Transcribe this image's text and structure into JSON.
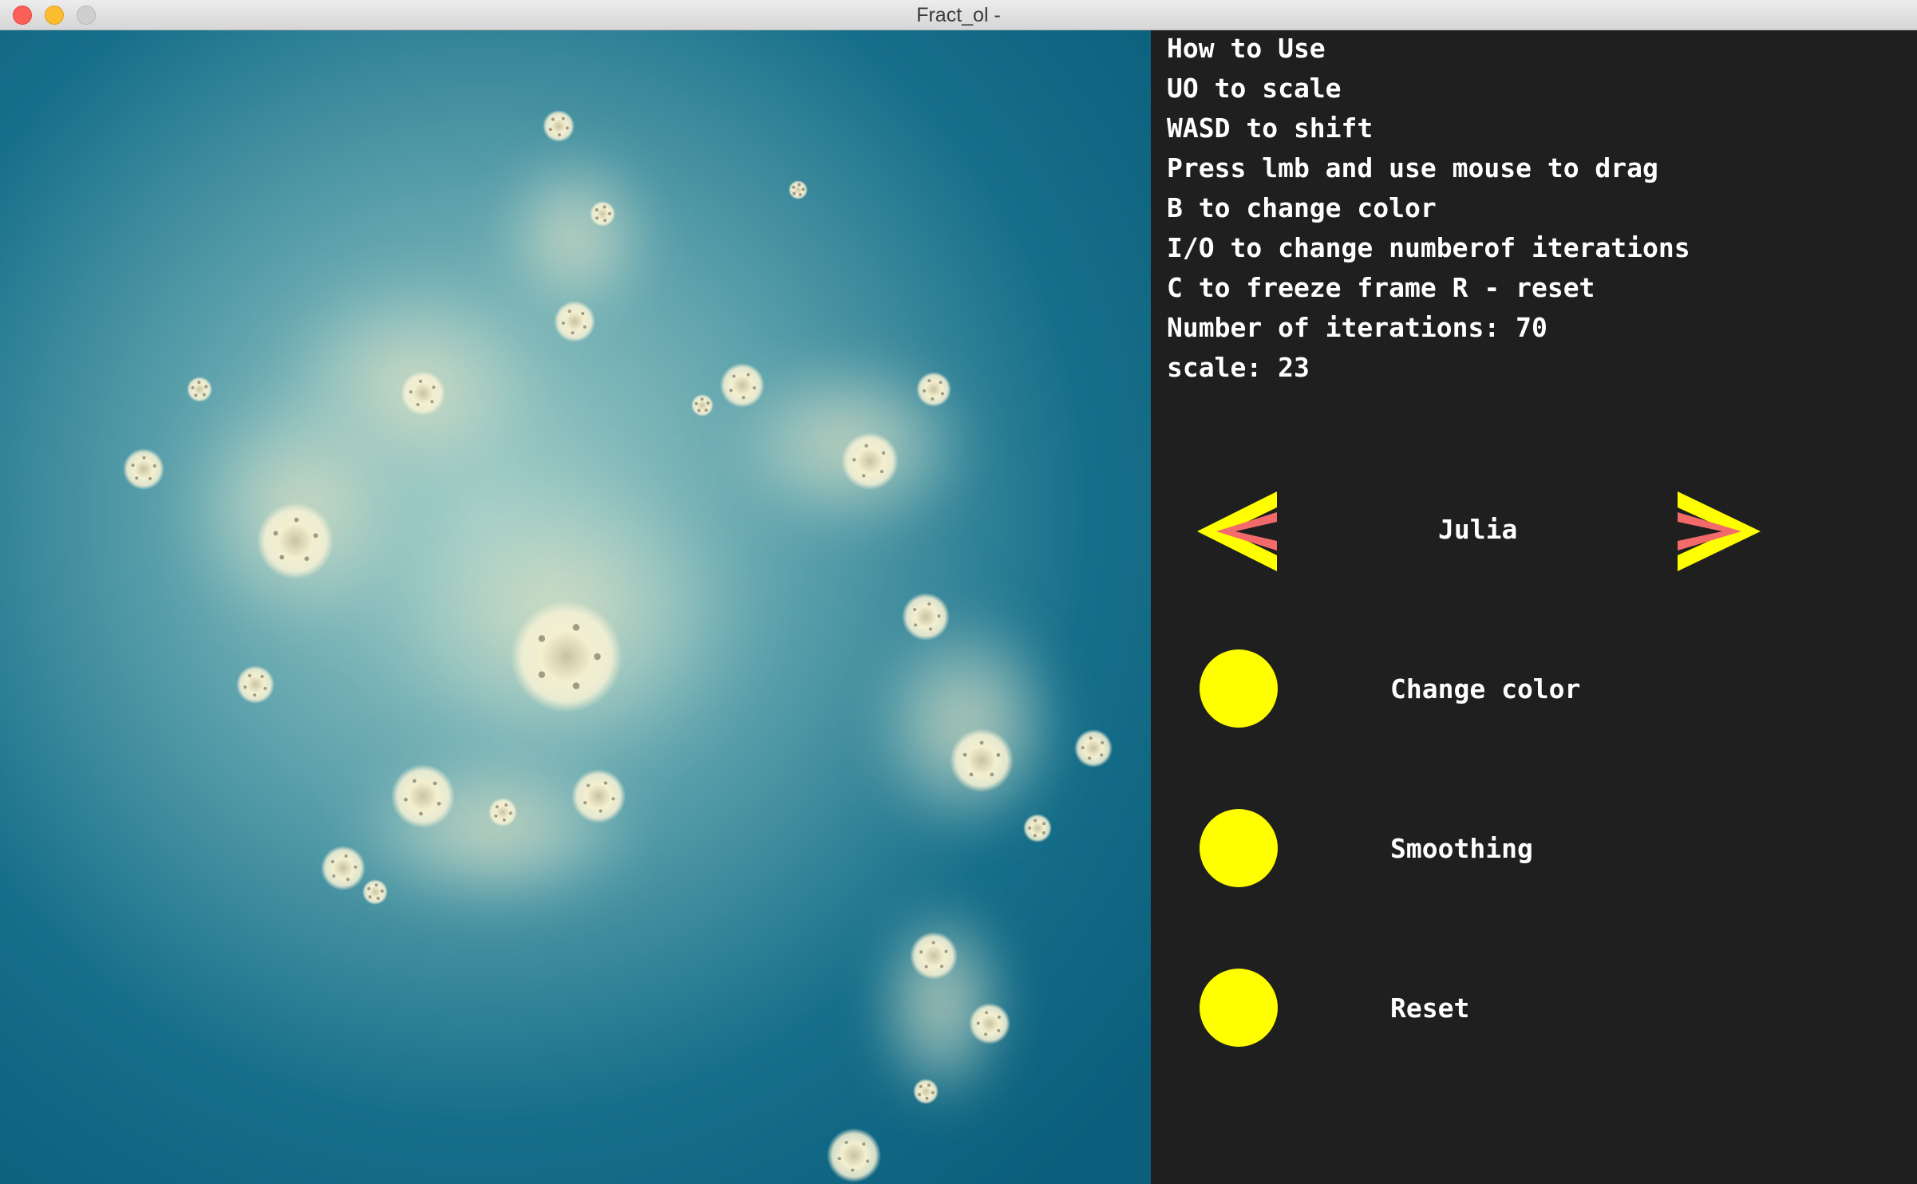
{
  "window": {
    "title": "Fract_ol -"
  },
  "help": {
    "lines": [
      "How to Use",
      "UO to scale",
      "WASD to shift",
      "Press lmb and use mouse to drag",
      "B to change color",
      "I/O to change numberof iterations",
      "C to freeze frame R - reset",
      "Number of iterations: 70",
      "scale: 23"
    ]
  },
  "selector": {
    "current_fractal": "Julia",
    "prev_icon": "chevron-left-icon",
    "next_icon": "chevron-right-icon"
  },
  "options": [
    {
      "label": "Change color",
      "icon": "circle-button"
    },
    {
      "label": "Smoothing",
      "icon": "circle-button"
    },
    {
      "label": "Reset",
      "icon": "circle-button"
    }
  ],
  "colors": {
    "panel_background": "#1f1f1f",
    "fractal_background": "#0d6684",
    "fractal_glow": "#a9cfc7",
    "fractal_highlight": "#f1ecc8",
    "button_yellow": "#ffff00",
    "arrow_inner": "#f26a6a"
  }
}
